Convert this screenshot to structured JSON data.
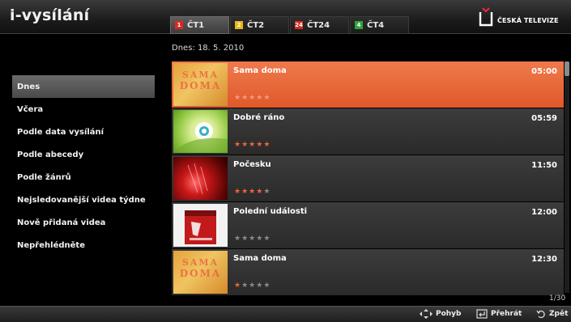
{
  "header": {
    "brand": "i-vysílání",
    "channel_tabs": [
      {
        "label": "ČT1",
        "logo": "1",
        "color": "#d8291f"
      },
      {
        "label": "ČT2",
        "logo": "2",
        "color": "#e8b51a"
      },
      {
        "label": "ČT24",
        "logo": "24",
        "color": "#d8291f"
      },
      {
        "label": "ČT4",
        "logo": "4",
        "color": "#2fa33a"
      }
    ],
    "broadcaster": "ČESKÁ TELEVIZE"
  },
  "date_label": "Dnes: 18. 5. 2010",
  "sidebar": {
    "items": [
      {
        "label": "Dnes"
      },
      {
        "label": "Včera"
      },
      {
        "label": "Podle data vysílání"
      },
      {
        "label": "Podle abecedy"
      },
      {
        "label": "Podle žánrů"
      },
      {
        "label": "Nejsledovanější videa týdne"
      },
      {
        "label": "Nově přidaná videa"
      },
      {
        "label": "Nepřehlédněte"
      }
    ]
  },
  "programs": [
    {
      "title": "Sama doma",
      "time": "05:00",
      "rating": 0,
      "thumb_text": [
        "SAMA",
        "DOMA"
      ]
    },
    {
      "title": "Dobré ráno",
      "time": "05:59",
      "rating": 5
    },
    {
      "title": "Počesku",
      "time": "11:50",
      "rating": 4
    },
    {
      "title": "Polední události",
      "time": "12:00",
      "rating": 0
    },
    {
      "title": "Sama doma",
      "time": "12:30",
      "rating": 1,
      "thumb_text": [
        "SAMA",
        "DOMA"
      ]
    }
  ],
  "page_counter": "1/30",
  "footer": {
    "move": "Pohyb",
    "play": "Přehrát",
    "back": "Zpět"
  },
  "colors": {
    "accent": "#e8633a",
    "star_on": "#f2643a",
    "star_off": "#8b8b8b"
  }
}
